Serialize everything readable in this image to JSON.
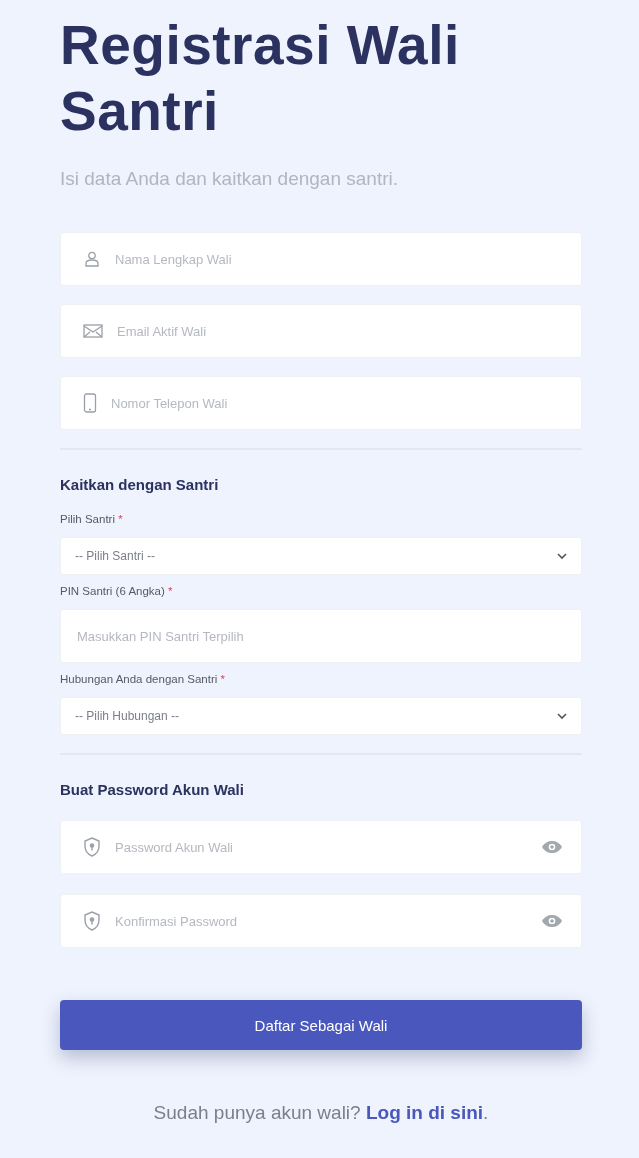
{
  "title": "Registrasi Wali Santri",
  "subtitle": "Isi data Anda dan kaitkan dengan santri.",
  "guardian_fields": [
    {
      "kind": "name",
      "placeholder": "Nama Lengkap Wali"
    },
    {
      "kind": "email",
      "placeholder": "Email Aktif Wali"
    },
    {
      "kind": "phone",
      "placeholder": "Nomor Telepon Wali"
    }
  ],
  "link_section": {
    "heading": "Kaitkan dengan Santri",
    "fields": [
      {
        "kind": "select",
        "label": "Pilih Santri",
        "required_mark": "*",
        "value": "-- Pilih Santri --"
      },
      {
        "kind": "input",
        "label": "PIN Santri (6 Angka)",
        "required_mark": "*",
        "placeholder": "Masukkan PIN Santri Terpilih"
      },
      {
        "kind": "select",
        "label": "Hubungan Anda dengan Santri",
        "required_mark": "*",
        "value": "-- Pilih Hubungan --"
      }
    ]
  },
  "password_section": {
    "heading": "Buat Password Akun Wali",
    "fields": [
      {
        "kind": "password",
        "placeholder": "Password Akun Wali"
      },
      {
        "kind": "password",
        "placeholder": "Konfirmasi Password"
      }
    ]
  },
  "submit_button": "Daftar Sebagai Wali",
  "footer": {
    "text": "Sudah punya akun wali?",
    "link": "Log in di sini",
    "end": "."
  }
}
